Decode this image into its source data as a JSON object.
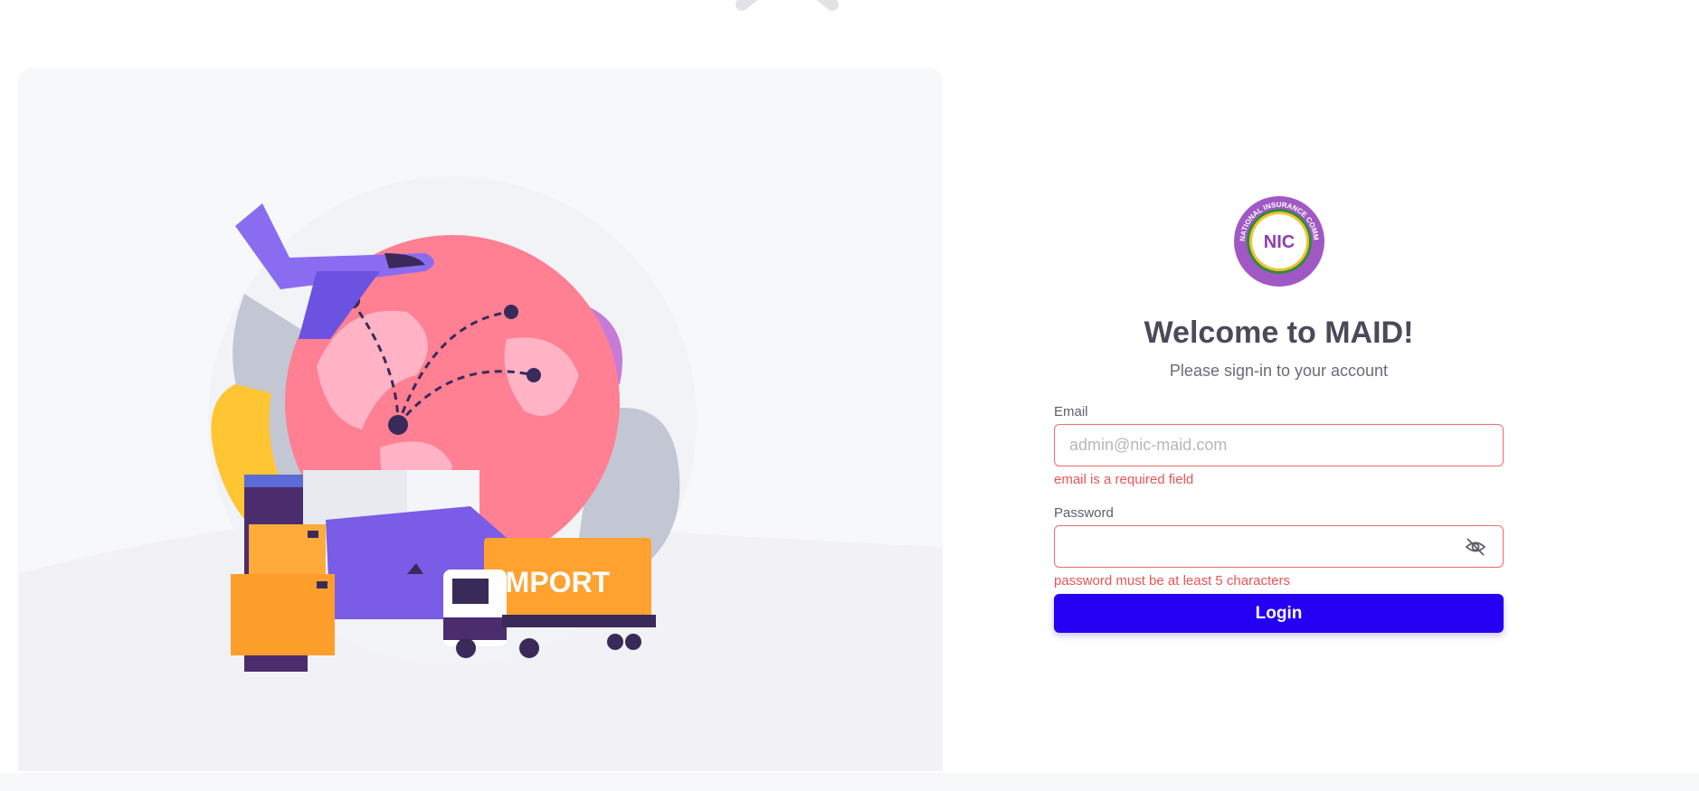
{
  "illustration": {
    "icon": "logistics-import-illustration",
    "truck_text": "IMPORT"
  },
  "logo": {
    "icon": "nic-logo",
    "ring_text": "NATIONAL INSURANCE COMMISSION",
    "center_text": "NIC"
  },
  "header": {
    "title": "Welcome to MAID!",
    "subtitle": "Please sign-in to your account"
  },
  "form": {
    "email": {
      "label": "Email",
      "placeholder": "admin@nic-maid.com",
      "value": "",
      "error": "email is a required field"
    },
    "password": {
      "label": "Password",
      "value": "",
      "toggle_icon": "eye-off-icon",
      "error": "password must be at least 5 characters"
    },
    "login_label": "Login"
  },
  "colors": {
    "primary": "#2400f2",
    "error": "#ea5455",
    "panel_bg": "#f7f8f9",
    "text": "#4a4a5a"
  }
}
